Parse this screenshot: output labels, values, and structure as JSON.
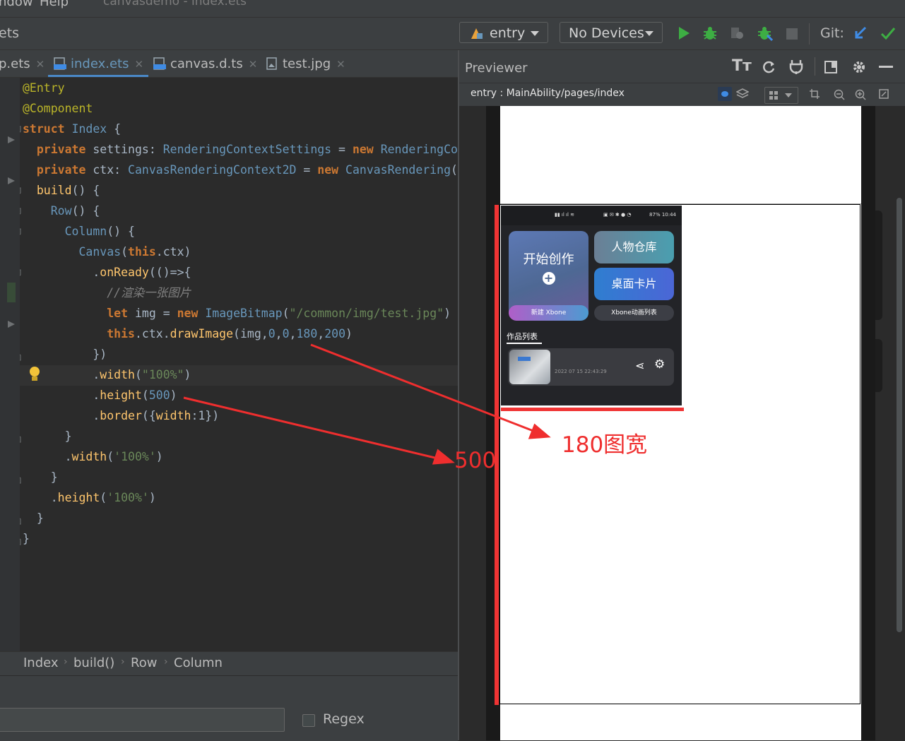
{
  "menubar": {
    "items": [
      "ndow",
      "Help"
    ],
    "title": "canvasdemo - index.ets"
  },
  "toolbar": {
    "left_label": "ets",
    "module_select": "entry",
    "device_select": "No Devices",
    "git_label": "Git:"
  },
  "tabs": [
    {
      "label": "p.ets"
    },
    {
      "label": "index.ets",
      "active": true
    },
    {
      "label": "canvas.d.ts"
    },
    {
      "label": "test.jpg"
    }
  ],
  "editor": {
    "lines": [
      "@Entry",
      "@Component",
      "struct Index {",
      "  private settings: RenderingContextSettings = new RenderingCo",
      "  private ctx: CanvasRenderingContext2D = new CanvasRendering(",
      "  build() {",
      "    Row() {",
      "      Column() {",
      "        Canvas(this.ctx)",
      "          .onReady(()=>{",
      "            //渲染一张图片",
      "            let img = new ImageBitmap(\"/common/img/test.jpg\")",
      "            this.ctx.drawImage(img,0,0,180,200)",
      "          })",
      "          .width(\"100%\")",
      "          .height(500)",
      "          .border({width:1})",
      "      }",
      "      .width('100%')",
      "    }",
      "    .height('100%')",
      "  }",
      "}"
    ]
  },
  "breadcrumb": [
    "Index",
    "build()",
    "Row",
    "Column"
  ],
  "findbar": {
    "regex_label": "Regex"
  },
  "previewer": {
    "title": "Previewer",
    "path": "entry : MainAbility/pages/index"
  },
  "app_screenshot": {
    "status_bar": "87% 10:44",
    "card_start": "开始创作",
    "card_library": "人物仓库",
    "card_desktop": "桌面卡片",
    "pill_new": "新建 Xbone",
    "pill_list": "Xbone动画列表",
    "section_title": "作品列表",
    "item_date": "2022 07 15 22:43:29"
  },
  "annotations": {
    "height_label": "500",
    "width_label": "180图宽"
  },
  "colors": {
    "annotation_red": "#f03434",
    "keyword": "#cc7832",
    "string": "#6a8759",
    "accent_tab": "#4a88c7",
    "run_green": "#3dae43"
  }
}
